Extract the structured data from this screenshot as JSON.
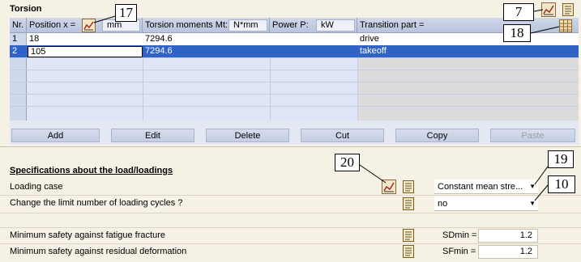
{
  "section1": {
    "title": "Torsion",
    "headers": {
      "nr": "Nr.",
      "position": "Position x =",
      "position_unit": "mm",
      "moments": "Torsion moments Mt:",
      "moments_unit": "N*mm",
      "power": "Power P:",
      "power_unit": "kW",
      "transition": "Transition  part ="
    },
    "rows": [
      {
        "nr": "1",
        "position": "18",
        "moment": "7294.6",
        "power": "",
        "transition": "drive"
      },
      {
        "nr": "2",
        "position": "105",
        "moment": "7294.6",
        "power": "",
        "transition": "takeoff"
      }
    ],
    "buttons": {
      "add": "Add",
      "edit": "Edit",
      "delete": "Delete",
      "cut": "Cut",
      "copy": "Copy",
      "paste": "Paste"
    }
  },
  "section2": {
    "title": "Specifications about the load/loadings",
    "loading_case_label": "Loading case",
    "loading_case_value": "Constant mean stre...",
    "limit_cycles_label": "Change the limit number of loading cycles ?",
    "limit_cycles_value": "no",
    "fatigue_label": "Minimum safety against fatigue fracture",
    "sdmin_label": "SDmin =",
    "sdmin_value": "1.2",
    "residual_label": "Minimum safety against residual deformation",
    "sfmin_label": "SFmin =",
    "sfmin_value": "1.2"
  },
  "callouts": {
    "c17": "17",
    "c7": "7",
    "c18": "18",
    "c20": "20",
    "c19": "19",
    "c10": "10"
  },
  "colors": {
    "selected_row": "#3163c5",
    "panel_bg": "#f5f1e4",
    "header_bg": "#c4cde3"
  }
}
